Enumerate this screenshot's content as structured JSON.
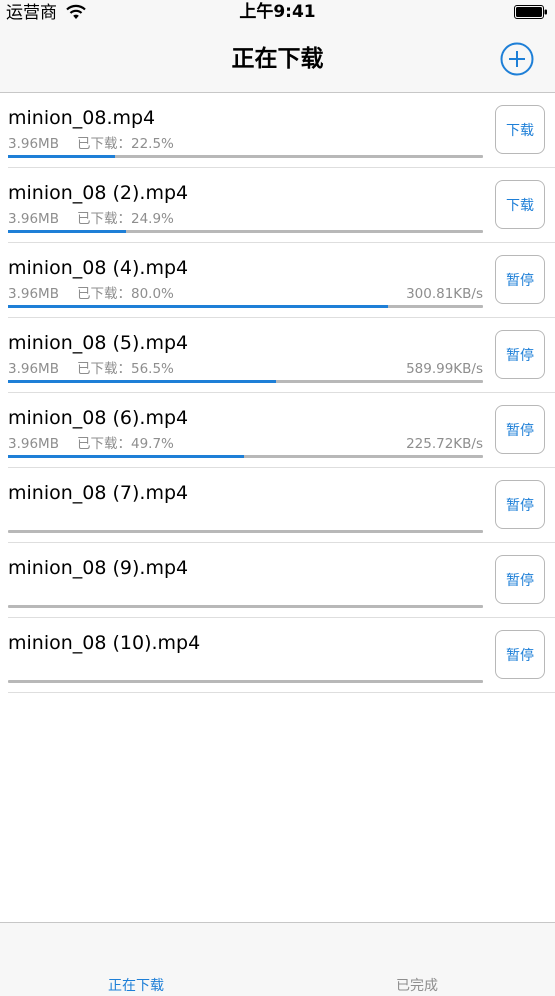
{
  "status_bar": {
    "carrier": "运营商",
    "time": "上午9:41"
  },
  "nav": {
    "title": "正在下载"
  },
  "colors": {
    "accent": "#1e7fd7",
    "muted_text": "#8e8e8e",
    "track": "#b8b8b8"
  },
  "downloads": [
    {
      "name": "minion_08.mp4",
      "size": "3.96MB",
      "downloaded": "已下载：22.5%",
      "speed": "",
      "progress": 0.225,
      "action": "下载"
    },
    {
      "name": "minion_08 (2).mp4",
      "size": "3.96MB",
      "downloaded": "已下载：24.9%",
      "speed": "",
      "progress": 0.249,
      "action": "下载"
    },
    {
      "name": "minion_08 (4).mp4",
      "size": "3.96MB",
      "downloaded": "已下载：80.0%",
      "speed": "300.81KB/s",
      "progress": 0.8,
      "action": "暂停"
    },
    {
      "name": "minion_08 (5).mp4",
      "size": "3.96MB",
      "downloaded": "已下载：56.5%",
      "speed": "589.99KB/s",
      "progress": 0.565,
      "action": "暂停"
    },
    {
      "name": "minion_08 (6).mp4",
      "size": "3.96MB",
      "downloaded": "已下载：49.7%",
      "speed": "225.72KB/s",
      "progress": 0.497,
      "action": "暂停"
    },
    {
      "name": "minion_08 (7).mp4",
      "size": "",
      "downloaded": "",
      "speed": "",
      "progress": 0,
      "action": "暂停"
    },
    {
      "name": "minion_08 (9).mp4",
      "size": "",
      "downloaded": "",
      "speed": "",
      "progress": 0,
      "action": "暂停"
    },
    {
      "name": "minion_08 (10).mp4",
      "size": "",
      "downloaded": "",
      "speed": "",
      "progress": 0,
      "action": "暂停"
    }
  ],
  "tabs": [
    {
      "label": "正在下载",
      "active": true
    },
    {
      "label": "已完成",
      "active": false
    }
  ]
}
